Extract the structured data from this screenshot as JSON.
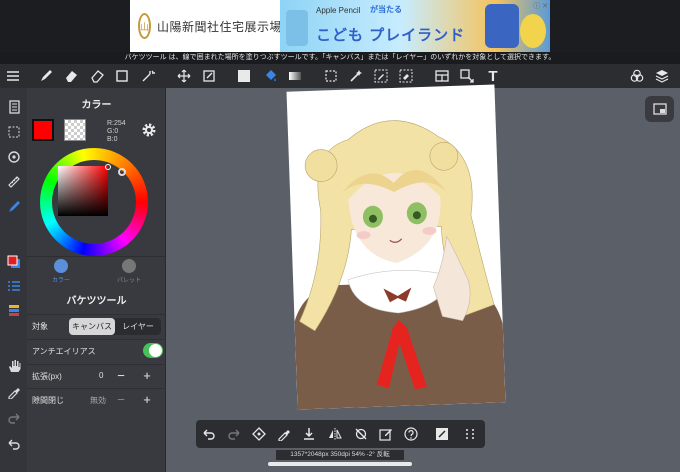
{
  "ad": {
    "company": "山陽新聞社住宅展示場",
    "logo_text": "山",
    "product": "Apple Pencil",
    "tagline": "が当たる",
    "headline": "こども プレイランド"
  },
  "hint": {
    "text": "バケツツール は、線で囲まれた場所を塗りつぶすツールです。「キャンバス」または「レイヤー」のいずれかを対象として選択できます。"
  },
  "toolbar": {
    "icons": [
      "menu-icon",
      "pen-icon",
      "eraser-icon",
      "soft-eraser-icon",
      "rect-select-icon",
      "wand-icon",
      "move-icon",
      "transform-icon",
      "fill-color-icon",
      "bucket-icon",
      "gradient-icon",
      "lasso-select-icon",
      "magic-wand-icon",
      "select-pen-icon",
      "select-eraser-icon",
      "frame-icon",
      "operation-icon",
      "text-icon",
      "materials-icon",
      "layers-icon"
    ],
    "text_tool_glyph": "T"
  },
  "leftcol": {
    "icons": [
      "pages-icon",
      "selection-icon",
      "rotate-icon",
      "ruler-icon",
      "brush-settings-icon",
      "color-icon",
      "layer-list-icon",
      "stack-icon",
      "hand-icon",
      "eyedropper-icon",
      "redo-icon",
      "undo-icon"
    ]
  },
  "colorpanel": {
    "title": "カラー",
    "main_color": "#FE0000",
    "rgb": {
      "r": "R:254",
      "g": "G:0",
      "b": "B:0"
    },
    "tabs": [
      {
        "label": "カラー",
        "active": true
      },
      {
        "label": "パレット",
        "active": false
      }
    ]
  },
  "bucket": {
    "title": "バケツツール",
    "target_label": "対象",
    "target_options": [
      "キャンバス",
      "レイヤー"
    ],
    "target_selected": "キャンバス",
    "antialias_label": "アンチエイリアス",
    "antialias_on": true,
    "expand_label": "拡張(px)",
    "expand_value": "0",
    "gap_label": "隙間閉じ",
    "gap_value": "無効",
    "minus": "−",
    "plus": "+"
  },
  "bottom": {
    "icons": [
      "undo-icon",
      "redo-icon",
      "transform-icon",
      "eyedropper-icon",
      "save-icon",
      "flip-icon",
      "snap-off-icon",
      "edit-icon",
      "help-icon",
      "fullscreen-icon",
      "more-icon"
    ],
    "status": "1357*2048px 350dpi 54% -2° 反転"
  }
}
